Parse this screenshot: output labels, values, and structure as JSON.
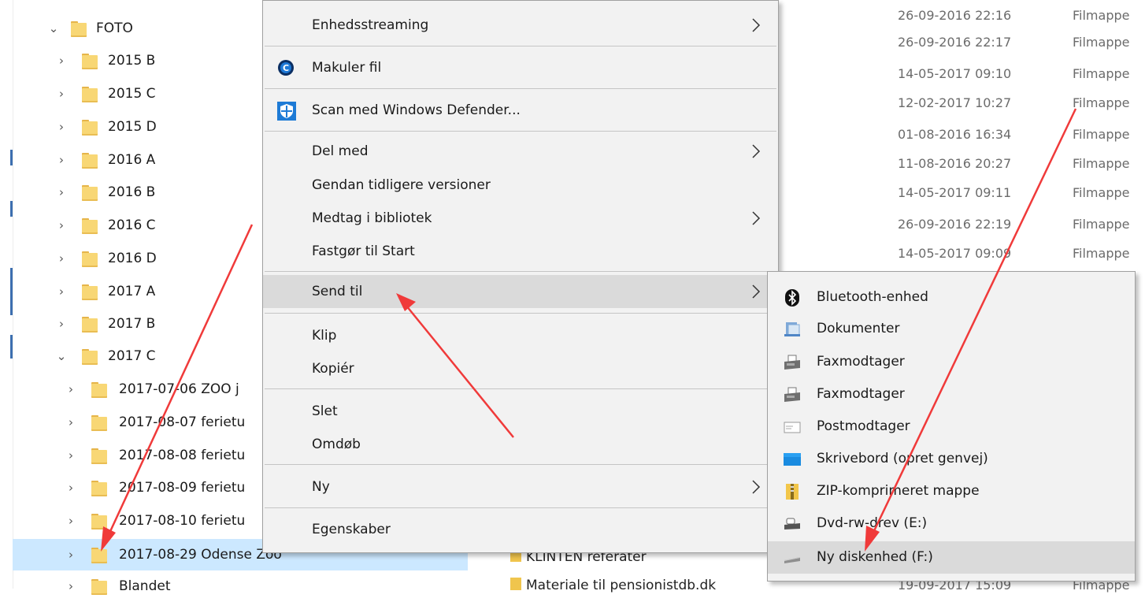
{
  "nav": {
    "items": [
      {
        "label": "FOTO",
        "expanded": true
      },
      {
        "label": "2015 B"
      },
      {
        "label": "2015 C"
      },
      {
        "label": "2015 D"
      },
      {
        "label": "2016 A"
      },
      {
        "label": "2016 B"
      },
      {
        "label": "2016 C"
      },
      {
        "label": "2016 D"
      },
      {
        "label": "2017 A"
      },
      {
        "label": "2017 B"
      },
      {
        "label": "2017 C",
        "expanded": true
      },
      {
        "label": "2017-07-06 ZOO j"
      },
      {
        "label": "2017-08-07 ferietu"
      },
      {
        "label": "2017-08-08 ferietu"
      },
      {
        "label": "2017-08-09 ferietu"
      },
      {
        "label": "2017-08-10 ferietu"
      },
      {
        "label": "2017-08-29 Odense Zoo",
        "selected": true
      },
      {
        "label": "Blandet"
      }
    ]
  },
  "list": {
    "dates": [
      "26-09-2016 22:16",
      "26-09-2016 22:17",
      "14-05-2017 09:10",
      "12-02-2017 10:27",
      "01-08-2016 16:34",
      "11-08-2016 20:27",
      "14-05-2017 09:11",
      "26-09-2016 22:19",
      "14-05-2017 09:09"
    ],
    "type_label": "Filmappe",
    "bottom_files": [
      {
        "name": "KLINTEN referater"
      },
      {
        "name": "Materiale til pensionistdb.dk",
        "date": "19-09-2017 15:09",
        "type": "Filmappe"
      }
    ]
  },
  "context_menu": {
    "items": {
      "streaming": "Enhedsstreaming",
      "shred": "Makuler fil",
      "defender": "Scan med Windows Defender...",
      "share": "Del med",
      "restore": "Gendan tidligere versioner",
      "library": "Medtag i bibliotek",
      "pin": "Fastgør til Start",
      "sendto": "Send til",
      "cut": "Klip",
      "copy": "Kopiér",
      "delete": "Slet",
      "rename": "Omdøb",
      "new": "Ny",
      "properties": "Egenskaber"
    }
  },
  "sendto_menu": {
    "items": [
      {
        "label": "Bluetooth-enhed",
        "icon": "bluetooth-icon"
      },
      {
        "label": "Dokumenter",
        "icon": "documents-icon"
      },
      {
        "label": "Faxmodtager",
        "icon": "fax-icon"
      },
      {
        "label": "Faxmodtager",
        "icon": "fax-icon"
      },
      {
        "label": "Postmodtager",
        "icon": "mail-icon"
      },
      {
        "label": "Skrivebord (opret genvej)",
        "icon": "desktop-icon"
      },
      {
        "label": "ZIP-komprimeret mappe",
        "icon": "zip-folder-icon"
      },
      {
        "label": "Dvd-rw-drev (E:)",
        "icon": "dvd-drive-icon"
      },
      {
        "label": "Ny diskenhed (F:)",
        "icon": "removable-drive-icon",
        "highlighted": true
      }
    ]
  },
  "colors": {
    "selection": "#cce8ff",
    "menu_bg": "#f2f2f2",
    "menu_highlight": "#dadada",
    "annotation_arrow": "#f03a3a"
  }
}
